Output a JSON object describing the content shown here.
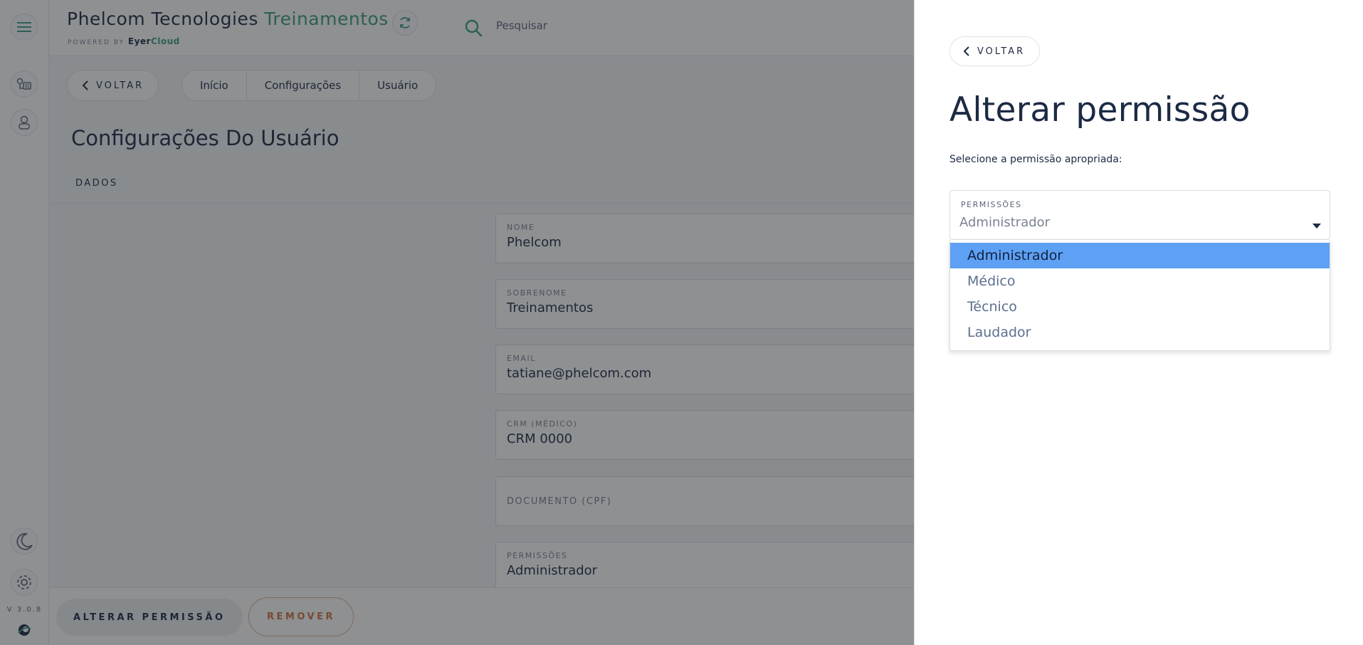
{
  "app": {
    "brand_name": "Phelcom Tecnologies",
    "brand_org": "Treinamentos",
    "powered_by": "POWERED BY",
    "powered_eyer": "Eyer",
    "powered_cloud": "Cloud",
    "version": "V 3.0.8"
  },
  "search": {
    "placeholder": "Pesquisar"
  },
  "nav": {
    "back_label": "VOLTAR",
    "breadcrumb": [
      "Início",
      "Configurações",
      "Usuário"
    ]
  },
  "page": {
    "title": "Configurações Do Usuário",
    "tab": "DADOS"
  },
  "form": {
    "fields": [
      {
        "label": "NOME",
        "value": "Phelcom"
      },
      {
        "label": "SOBRENOME",
        "value": "Treinamentos"
      },
      {
        "label": "EMAIL",
        "value": "tatiane@phelcom.com"
      },
      {
        "label": "CRM (MÉDICO)",
        "value": "CRM 0000"
      },
      {
        "label": "DOCUMENTO (CPF)",
        "value": ""
      },
      {
        "label": "PERMISSÕES",
        "value": "Administrador"
      }
    ]
  },
  "actions": {
    "change_permission": "ALTERAR PERMISSÃO",
    "remove": "REMOVER"
  },
  "drawer": {
    "back_label": "VOLTAR",
    "title": "Alterar permissão",
    "subtitle": "Selecione a permissão apropriada:",
    "select_label": "PERMISSÕES",
    "select_value": "Administrador",
    "options": [
      "Administrador",
      "Médico",
      "Técnico",
      "Laudador"
    ],
    "selected_option": "Administrador"
  },
  "colors": {
    "accent": "#3c9c82",
    "remove": "#d0713c",
    "option_highlight": "#5ea0f4",
    "text": "#1c2a44"
  },
  "icons": [
    "menu-icon",
    "exam-list-icon",
    "user-icon",
    "moon-icon",
    "gear-icon",
    "eyer-logo-icon",
    "refresh-icon",
    "search-icon",
    "chevron-left-icon",
    "caret-down-icon"
  ]
}
